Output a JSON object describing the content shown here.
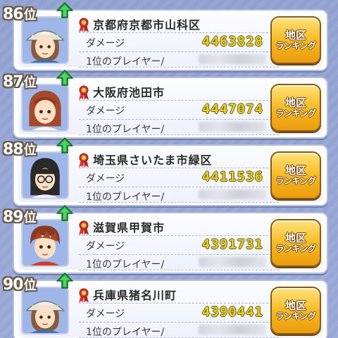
{
  "colors": {
    "background": "#8e9fd0",
    "damage_text": "#e6cf2a",
    "button_gold": "#f6b71c",
    "up_arrow": "#22b03a",
    "ribbon": "#d8352a"
  },
  "labels": {
    "damage": "ダメージ",
    "top_player": "1位のプレイヤー/",
    "button_line1": "地区",
    "button_line2": "ランキング",
    "rank_suffix": "位"
  },
  "rows": [
    {
      "rank": "86",
      "area": "京都府京都市山科区",
      "damage": "4463828",
      "avatar": "hat-girl-avatar",
      "trend": "up"
    },
    {
      "rank": "87",
      "area": "大阪府池田市",
      "damage": "4447074",
      "avatar": "brown-hair-girl-avatar",
      "trend": "up"
    },
    {
      "rank": "88",
      "area": "埼玉県さいたま市緑区",
      "damage": "4411536",
      "avatar": "black-hair-glasses-avatar",
      "trend": "up"
    },
    {
      "rank": "89",
      "area": "滋賀県甲賀市",
      "damage": "4391731",
      "avatar": "brown-hair-boy-avatar",
      "trend": "up"
    },
    {
      "rank": "90",
      "area": "兵庫県猪名川町",
      "damage": "4390441",
      "avatar": "hat-girl-avatar",
      "trend": "up"
    }
  ]
}
